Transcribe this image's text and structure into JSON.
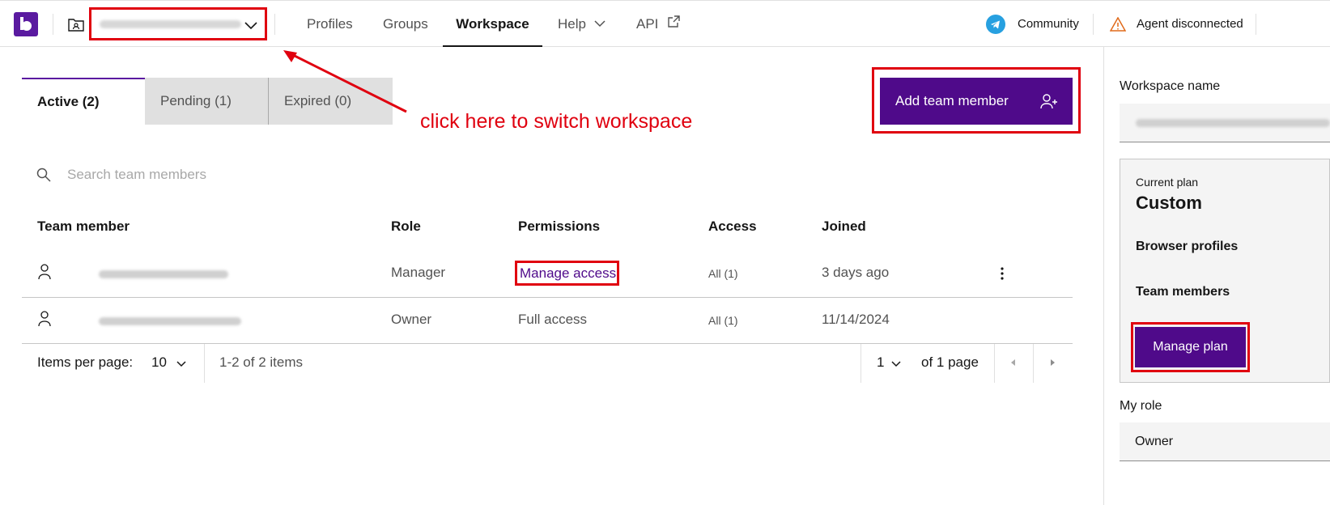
{
  "header": {
    "nav": [
      "Profiles",
      "Groups",
      "Workspace",
      "Help",
      "API"
    ],
    "active_nav": "Workspace",
    "community_label": "Community",
    "agent_status": "Agent disconnected"
  },
  "annotation": {
    "text": "click here to switch workspace",
    "color": "#e0000f"
  },
  "tabs": {
    "active": "Active (2)",
    "pending": "Pending (1)",
    "expired": "Expired (0)"
  },
  "actions": {
    "add_member": "Add team member"
  },
  "search": {
    "placeholder": "Search team members"
  },
  "table": {
    "headers": [
      "Team member",
      "Role",
      "Permissions",
      "Access",
      "Joined"
    ],
    "rows": [
      {
        "role": "Manager",
        "permissions": "Manage access",
        "access": "All (1)",
        "joined": "3 days ago"
      },
      {
        "role": "Owner",
        "permissions": "Full access",
        "access": "All (1)",
        "joined": "11/14/2024"
      }
    ]
  },
  "pagination": {
    "items_per_page_label": "Items per page:",
    "items_per_page": "10",
    "range": "1-2 of 2 items",
    "page": "1",
    "of_pages": "of 1 page"
  },
  "sidebar": {
    "workspace_name_label": "Workspace name",
    "current_plan_label": "Current plan",
    "plan_name": "Custom",
    "browser_profiles_label": "Browser profiles",
    "team_members_label": "Team members",
    "manage_plan": "Manage plan",
    "my_role_label": "My role",
    "my_role_value": "Owner"
  },
  "colors": {
    "brand": "#4f0a8a",
    "highlight": "#e0000f"
  }
}
